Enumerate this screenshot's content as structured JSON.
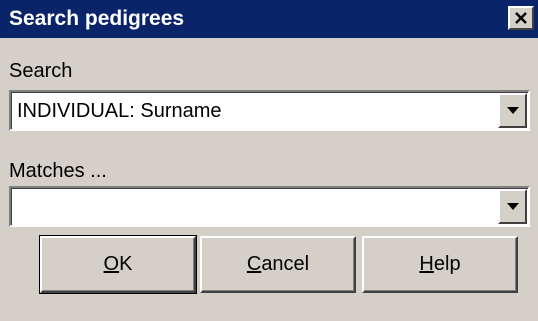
{
  "window": {
    "title": "Search pedigrees",
    "close_icon": "close-icon"
  },
  "search": {
    "label": "Search",
    "selected_value": "INDIVIDUAL: Surname",
    "dropdown_icon": "chevron-down-icon"
  },
  "matches": {
    "label": "Matches ...",
    "selected_value": "",
    "dropdown_icon": "chevron-down-icon"
  },
  "buttons": {
    "ok": {
      "accel": "O",
      "rest": "K"
    },
    "cancel": {
      "accel": "C",
      "rest": "ancel"
    },
    "help": {
      "accel": "H",
      "rest": "elp"
    }
  }
}
